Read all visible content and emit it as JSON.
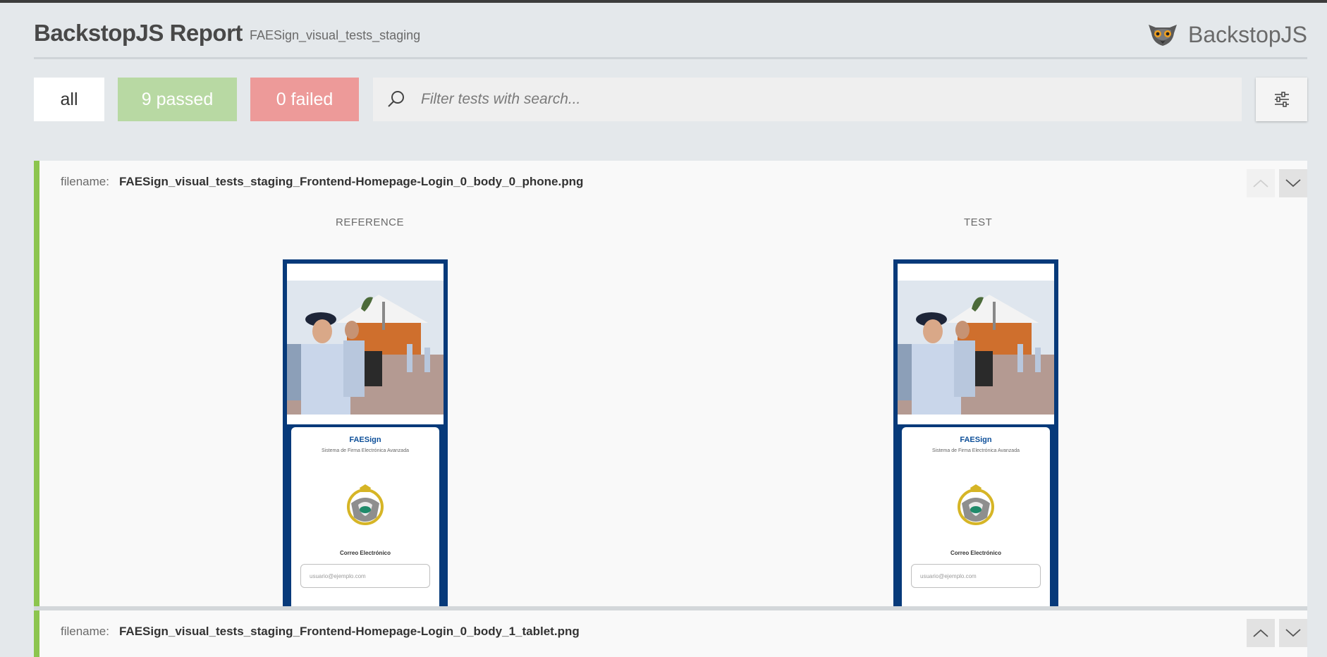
{
  "header": {
    "title": "BackstopJS Report",
    "subtitle": "FAESign_visual_tests_staging",
    "brand_name": "BackstopJS",
    "brand_icon": "lemur-logo-icon"
  },
  "toolbar": {
    "all_label": "all",
    "passed_label": "9 passed",
    "failed_label": "0 failed",
    "search_placeholder": "Filter tests with search...",
    "search_icon": "search-icon",
    "settings_icon": "settings-sliders-icon"
  },
  "colors": {
    "passed": "#b8d9a3",
    "failed": "#ed9a99",
    "pass_border": "#8cc54e",
    "phone_frame": "#073a7a"
  },
  "tests": [
    {
      "filename_label": "filename:",
      "filename": "FAESign_visual_tests_staging_Frontend-Homepage-Login_0_body_0_phone.png",
      "reference_label": "REFERENCE",
      "test_label": "TEST",
      "screenshot": {
        "app_title": "FAESign",
        "app_subtitle": "Sistema de Firma Electrónica Avanzada",
        "email_label": "Correo Electrónico",
        "email_placeholder": "usuario@ejemplo.com"
      }
    },
    {
      "filename_label": "filename:",
      "filename": "FAESign_visual_tests_staging_Frontend-Homepage-Login_0_body_1_tablet.png"
    }
  ]
}
